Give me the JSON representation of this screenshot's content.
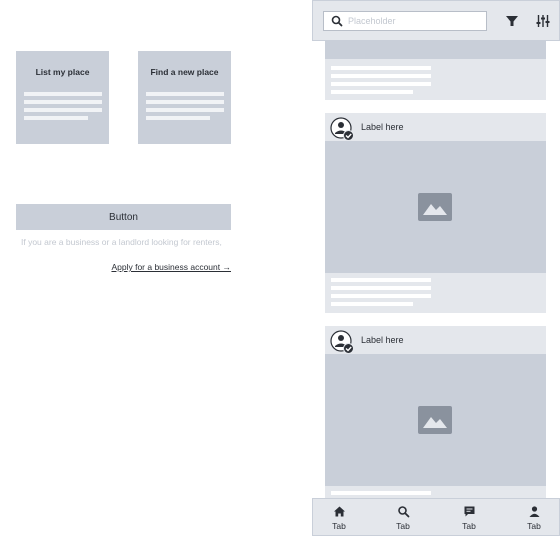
{
  "options": [
    {
      "title": "List my place"
    },
    {
      "title": "Find a new place"
    }
  ],
  "main_button": {
    "label": "Button"
  },
  "hint_text": "If you are a business or a landlord looking for renters,",
  "business_link": "Apply for a business account →",
  "search": {
    "placeholder": "Placeholder",
    "icon": "search-icon"
  },
  "toolbar": {
    "icons": [
      "filter-icon",
      "sliders-icon"
    ]
  },
  "feed": [
    {
      "label": "Label here"
    },
    {
      "label": "Label here"
    }
  ],
  "tabs": [
    {
      "label": "Tab",
      "icon": "home-icon"
    },
    {
      "label": "Tab",
      "icon": "search-icon"
    },
    {
      "label": "Tab",
      "icon": "chat-icon"
    },
    {
      "label": "Tab",
      "icon": "person-icon"
    }
  ],
  "colors": {
    "placeholder_fill": "#c9cfd9",
    "panel_fill": "#e4e7ec",
    "icon": "#2b2f36",
    "image_icon": "#8a929e",
    "muted_text": "#c3c8d0"
  }
}
